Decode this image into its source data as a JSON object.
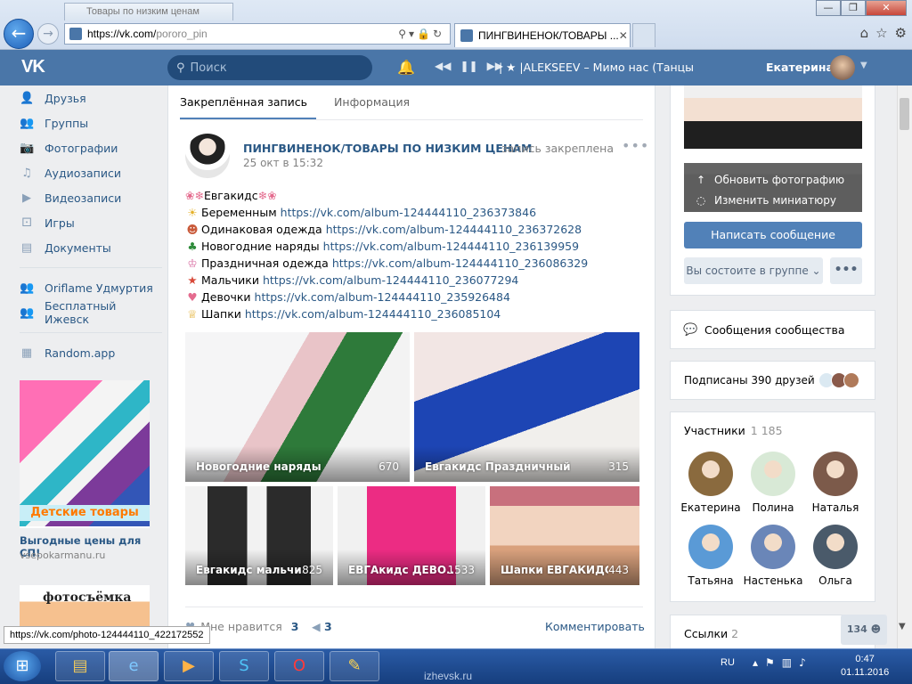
{
  "browser": {
    "address": {
      "url_host": "https://vk.com/",
      "url_path": "pororo_pin"
    },
    "bg_tab_title": "Товары по низким ценам",
    "active_tab_title": "ПИНГВИНЕНОК/ТОВАРЫ ...",
    "status_url": "https://vk.com/photo-124444110_422172552",
    "window_buttons": [
      "—",
      "❐",
      "✕"
    ]
  },
  "vk_header": {
    "logo": "VK",
    "search_placeholder": "Поиск",
    "now_playing": "| ★ |ALEKSEEV – Мимо нас (Танцы",
    "user_name": "Екатерина"
  },
  "left_nav": {
    "items": [
      {
        "label": "Друзья",
        "icon": "person-icon"
      },
      {
        "label": "Группы",
        "icon": "group-icon"
      },
      {
        "label": "Фотографии",
        "icon": "camera-icon"
      },
      {
        "label": "Аудиозаписи",
        "icon": "music-icon"
      },
      {
        "label": "Видеозаписи",
        "icon": "video-icon"
      },
      {
        "label": "Игры",
        "icon": "gamepad-icon"
      },
      {
        "label": "Документы",
        "icon": "document-icon"
      }
    ],
    "groups": [
      {
        "label": "Oriflame Удмуртия"
      },
      {
        "label": "Бесплатный Ижевск"
      }
    ],
    "apps": [
      {
        "label": "Random.app"
      }
    ],
    "ad1": {
      "banner_text": "Детские товары",
      "title": "Выгодные цены для СП!",
      "subtitle": "vsepokarmanu.ru"
    },
    "ad2": {
      "banner_text": "фотосъёмка"
    }
  },
  "tabs": [
    {
      "label": "Закреплённая запись"
    },
    {
      "label": "Информация"
    }
  ],
  "post": {
    "author": "ПИНГВИНЕНОК/ТОВАРЫ ПО НИЗКИМ ЦЕНАМ",
    "pinned": "запись закреплена",
    "date": "25 окт в 15:32",
    "title_line": {
      "emoji_left": "❀❄",
      "text": "Евгакидс",
      "emoji_right": "❄❀"
    },
    "lines": [
      {
        "emoji": "☀",
        "text": "Беременным ",
        "link": "https://vk.com/album-124444110_236373846"
      },
      {
        "emoji": "☻",
        "text": "Одинаковая одежда ",
        "link": "https://vk.com/album-124444110_236372628"
      },
      {
        "emoji": "♣",
        "text": "Новогодние наряды ",
        "link": "https://vk.com/album-124444110_236139959"
      },
      {
        "emoji": "♔",
        "text": "Праздничная одежда ",
        "link": "https://vk.com/album-124444110_236086329"
      },
      {
        "emoji": "★",
        "text": "Мальчики ",
        "link": "https://vk.com/album-124444110_236077294"
      },
      {
        "emoji": "♥",
        "text": "Девочки ",
        "link": "https://vk.com/album-124444110_235926484"
      },
      {
        "emoji": "♕",
        "text": "Шапки ",
        "link": "https://vk.com/album-124444110_236085104"
      }
    ],
    "albums": [
      {
        "caption": "Новогодние наряды",
        "count": "670"
      },
      {
        "caption": "Евгакидс Праздничный",
        "count": "315"
      },
      {
        "caption": "Евгакидс мальчи...",
        "count": "825"
      },
      {
        "caption": "ЕВГАкидс ДЕВО...",
        "count": "1533"
      },
      {
        "caption": "Шапки ЕВГАКИДС",
        "count": "443"
      }
    ],
    "likes_label": "Мне нравится",
    "likes_count": "3",
    "shares_count": "3",
    "comment_label": "Комментировать"
  },
  "right_col": {
    "cover_actions": [
      {
        "label": "Обновить фотографию",
        "icon": "upload-icon"
      },
      {
        "label": "Изменить миниатюру",
        "icon": "crop-icon"
      }
    ],
    "send_message": "Написать сообщение",
    "membership": "Вы состоите в группе ⌄",
    "more": "•••",
    "community_messages": "Сообщения сообщества",
    "friends_subscribed": "Подписаны 390 друзей",
    "members_title": "Участники",
    "members_count": "1 185",
    "members": [
      {
        "name": "Екатерина",
        "color": "#8a6a3e"
      },
      {
        "name": "Полина",
        "color": "#d8e9d6"
      },
      {
        "name": "Наталья",
        "color": "#7c5a4a"
      },
      {
        "name": "Татьяна",
        "color": "#5a9ad6"
      },
      {
        "name": "Настенька",
        "color": "#6a86b8"
      },
      {
        "name": "Ольга",
        "color": "#4a5a6a"
      }
    ],
    "links_title": "Ссылки",
    "links_count": "2",
    "online_count": "134"
  },
  "taskbar": {
    "watermark": "izhevsk.ru",
    "lang": "RU",
    "time": "0:47",
    "date": "01.11.2016"
  },
  "colors": {
    "vk_blue": "#4a76a8",
    "link": "#2a5885",
    "button": "#5181b8"
  }
}
